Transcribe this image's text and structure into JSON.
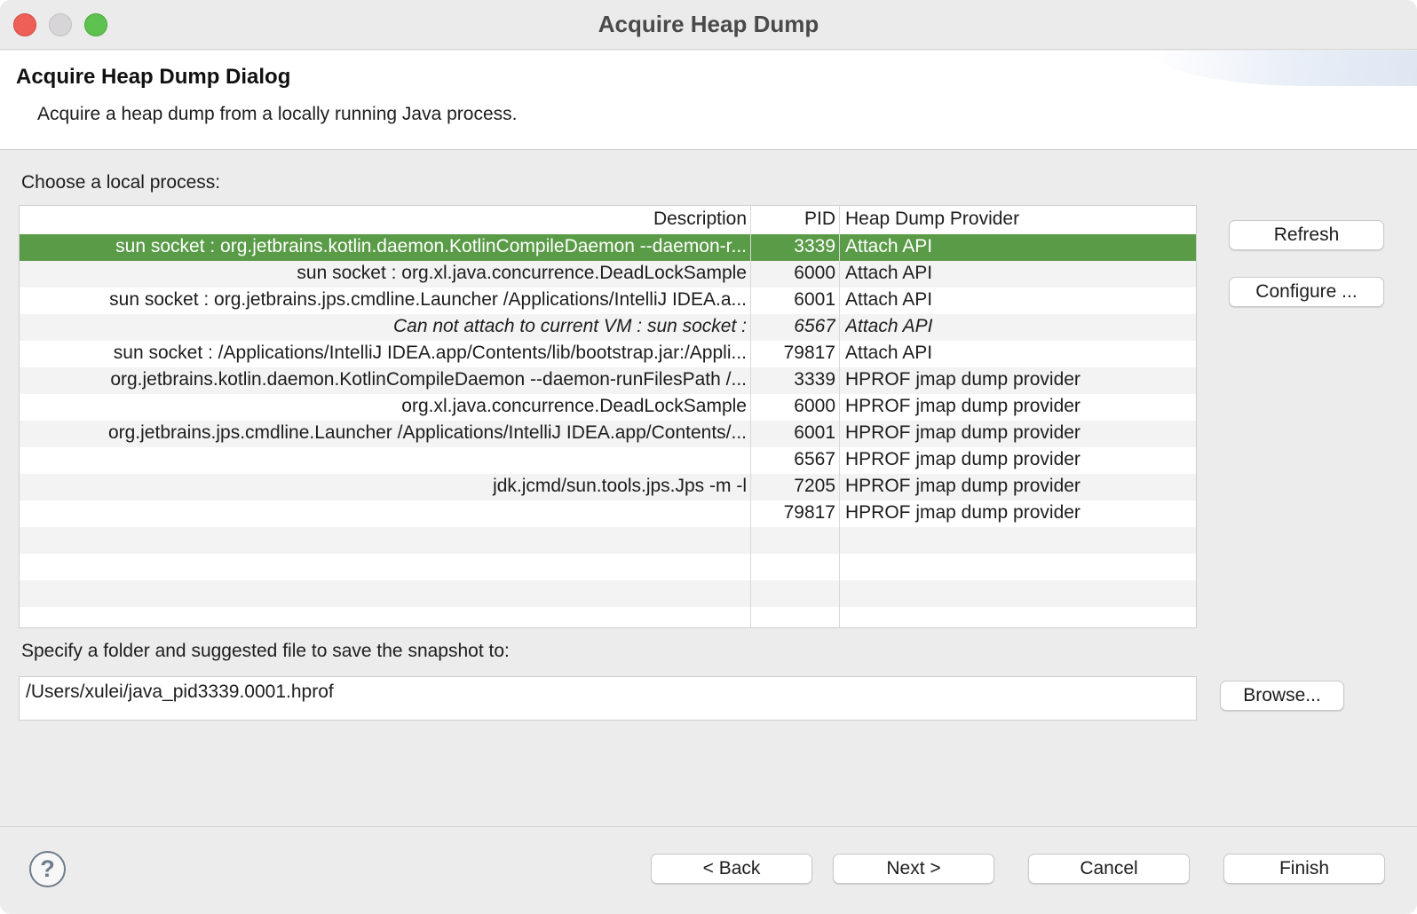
{
  "window": {
    "title": "Acquire Heap Dump"
  },
  "header": {
    "title": "Acquire Heap Dump Dialog",
    "description": "Acquire a heap dump from a locally running Java process."
  },
  "process_section": {
    "label": "Choose a local process:",
    "columns": {
      "description": "Description",
      "pid": "PID",
      "provider": "Heap Dump Provider"
    },
    "rows": [
      {
        "description": "sun socket : org.jetbrains.kotlin.daemon.KotlinCompileDaemon --daemon-r...",
        "pid": "3339",
        "provider": "Attach API",
        "selected": true
      },
      {
        "description": "sun socket : org.xl.java.concurrence.DeadLockSample",
        "pid": "6000",
        "provider": "Attach API"
      },
      {
        "description": "sun socket : org.jetbrains.jps.cmdline.Launcher /Applications/IntelliJ IDEA.a...",
        "pid": "6001",
        "provider": "Attach API"
      },
      {
        "description": "Can not attach to current VM : sun socket :",
        "pid": "6567",
        "provider": "Attach API",
        "italic": true
      },
      {
        "description": "sun socket : /Applications/IntelliJ IDEA.app/Contents/lib/bootstrap.jar:/Appli...",
        "pid": "79817",
        "provider": "Attach API"
      },
      {
        "description": "org.jetbrains.kotlin.daemon.KotlinCompileDaemon --daemon-runFilesPath /...",
        "pid": "3339",
        "provider": "HPROF jmap dump provider"
      },
      {
        "description": "org.xl.java.concurrence.DeadLockSample",
        "pid": "6000",
        "provider": "HPROF jmap dump provider"
      },
      {
        "description": "org.jetbrains.jps.cmdline.Launcher /Applications/IntelliJ IDEA.app/Contents/...",
        "pid": "6001",
        "provider": "HPROF jmap dump provider"
      },
      {
        "description": "",
        "pid": "6567",
        "provider": "HPROF jmap dump provider"
      },
      {
        "description": "jdk.jcmd/sun.tools.jps.Jps -m -l",
        "pid": "7205",
        "provider": "HPROF jmap dump provider"
      },
      {
        "description": "",
        "pid": "79817",
        "provider": "HPROF jmap dump provider"
      }
    ],
    "refresh_label": "Refresh",
    "configure_label": "Configure ..."
  },
  "folder_section": {
    "label": "Specify a folder and suggested file to save the snapshot to:",
    "path_value": "/Users/xulei/java_pid3339.0001.hprof",
    "browse_label": "Browse..."
  },
  "footer": {
    "help_glyph": "?",
    "back_label": "< Back",
    "next_label": "Next >",
    "cancel_label": "Cancel",
    "finish_label": "Finish"
  },
  "colors": {
    "selection": "#5a9b47",
    "close": "#ee5f57",
    "minimize": "#d7d5d7",
    "zoom": "#5ec24f"
  }
}
